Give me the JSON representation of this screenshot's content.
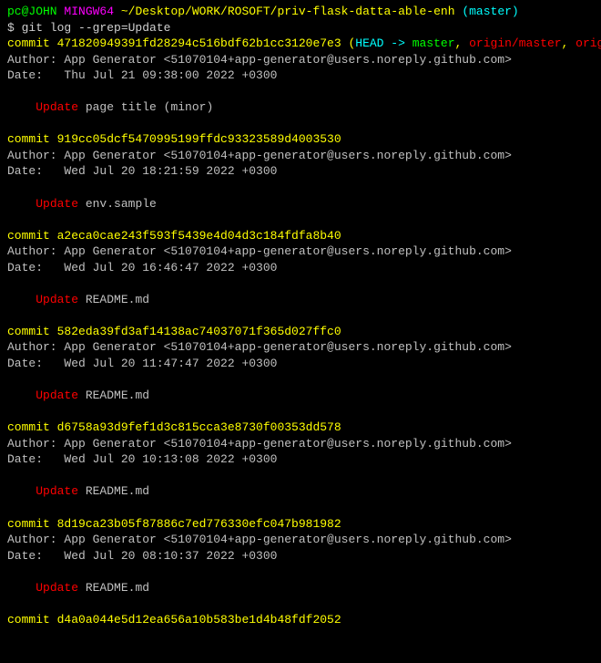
{
  "prompt": {
    "user": "pc@JOHN",
    "shell": "MINGW64",
    "path": "~/Desktop/WORK/ROSOFT/priv-flask-datta-able-enh",
    "branch": "(master)"
  },
  "command": "$ git log --grep=Update",
  "head": {
    "commit_prefix": "commit ",
    "hash": "471820949391fd28294c516bdf62b1cc3120e7e3",
    "open": " (",
    "head_label": "HEAD -> ",
    "master": "master",
    "sep1": ", ",
    "origin_master": "origin/master",
    "sep2": ", ",
    "origin_head": "origin/HEAD",
    "close": ")"
  },
  "commits": [
    {
      "author": "Author: App Generator <51070104+app-generator@users.noreply.github.com>",
      "date": "Date:   Thu Jul 21 09:38:00 2022 +0300",
      "msg_kw": "Update",
      "msg_rest": " page title (minor)"
    },
    {
      "line": "commit 919cc05dcf5470995199ffdc93323589d4003530",
      "author": "Author: App Generator <51070104+app-generator@users.noreply.github.com>",
      "date": "Date:   Wed Jul 20 18:21:59 2022 +0300",
      "msg_kw": "Update",
      "msg_rest": " env.sample"
    },
    {
      "line": "commit a2eca0cae243f593f5439e4d04d3c184fdfa8b40",
      "author": "Author: App Generator <51070104+app-generator@users.noreply.github.com>",
      "date": "Date:   Wed Jul 20 16:46:47 2022 +0300",
      "msg_kw": "Update",
      "msg_rest": " README.md"
    },
    {
      "line": "commit 582eda39fd3af14138ac74037071f365d027ffc0",
      "author": "Author: App Generator <51070104+app-generator@users.noreply.github.com>",
      "date": "Date:   Wed Jul 20 11:47:47 2022 +0300",
      "msg_kw": "Update",
      "msg_rest": " README.md"
    },
    {
      "line": "commit d6758a93d9fef1d3c815cca3e8730f00353dd578",
      "author": "Author: App Generator <51070104+app-generator@users.noreply.github.com>",
      "date": "Date:   Wed Jul 20 10:13:08 2022 +0300",
      "msg_kw": "Update",
      "msg_rest": " README.md"
    },
    {
      "line": "commit 8d19ca23b05f87886c7ed776330efc047b981982",
      "author": "Author: App Generator <51070104+app-generator@users.noreply.github.com>",
      "date": "Date:   Wed Jul 20 08:10:37 2022 +0300",
      "msg_kw": "Update",
      "msg_rest": " README.md"
    }
  ],
  "last_line": "commit d4a0a044e5d12ea656a10b583be1d4b48fdf2052"
}
